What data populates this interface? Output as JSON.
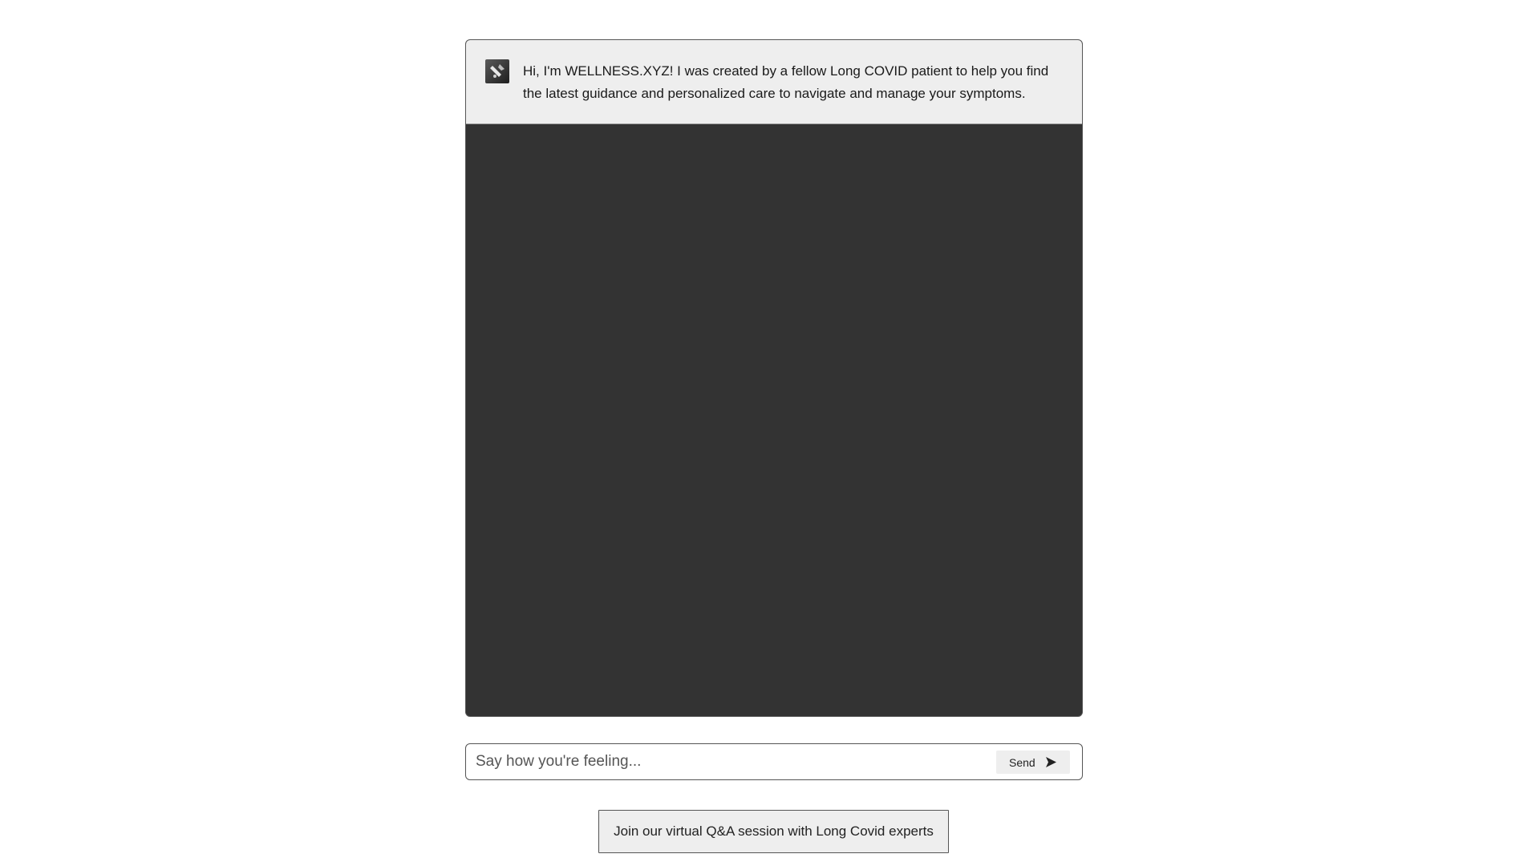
{
  "chat": {
    "avatar_icon": "bot-avatar-icon",
    "messages": [
      {
        "sender": "bot",
        "text": "Hi, I'm WELLNESS.XYZ! I was created by a fellow Long COVID patient to help you find the latest guidance and personalized care to navigate and manage your symptoms."
      }
    ]
  },
  "composer": {
    "placeholder": "Say how you're feeling...",
    "value": "",
    "send_label": "Send",
    "send_icon": "send-arrow-icon"
  },
  "cta": {
    "label": "Join our virtual Q&A session with Long Covid experts"
  },
  "colors": {
    "chat_background": "#333333",
    "message_background": "#eeeeee",
    "border": "#555555",
    "button_background": "#eeeeee",
    "text": "#1a1a1a"
  }
}
